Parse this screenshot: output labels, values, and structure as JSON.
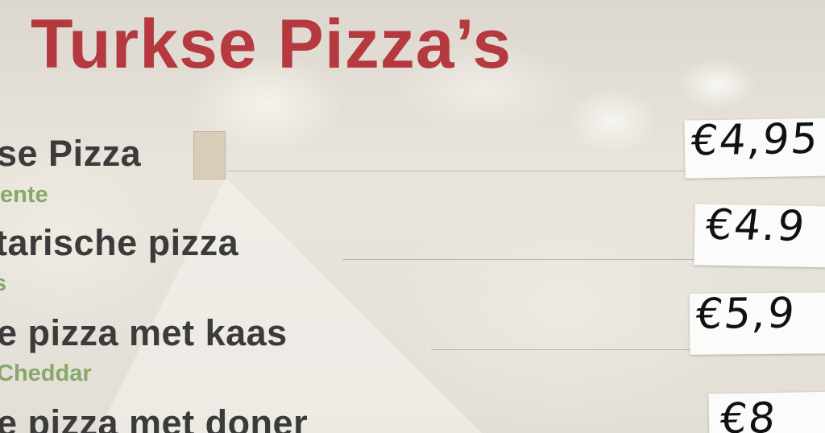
{
  "menu": {
    "title": "Turkse Pizza’s",
    "items": [
      {
        "name": "se Pizza",
        "description": "ente",
        "price": "€4,95"
      },
      {
        "name": "tarische pizza",
        "description": "s",
        "price": "€4.9"
      },
      {
        "name": "e pizza met kaas",
        "description": "Cheddar",
        "price": "€5,9"
      },
      {
        "name": "e pizza met doner",
        "description": "",
        "price": "€8"
      }
    ]
  },
  "colors": {
    "title": "#b5393f",
    "item_name": "#3b3b3b",
    "description": "#86a86a",
    "background": "#e6e2da",
    "price_tag": "#fbfbf9"
  }
}
